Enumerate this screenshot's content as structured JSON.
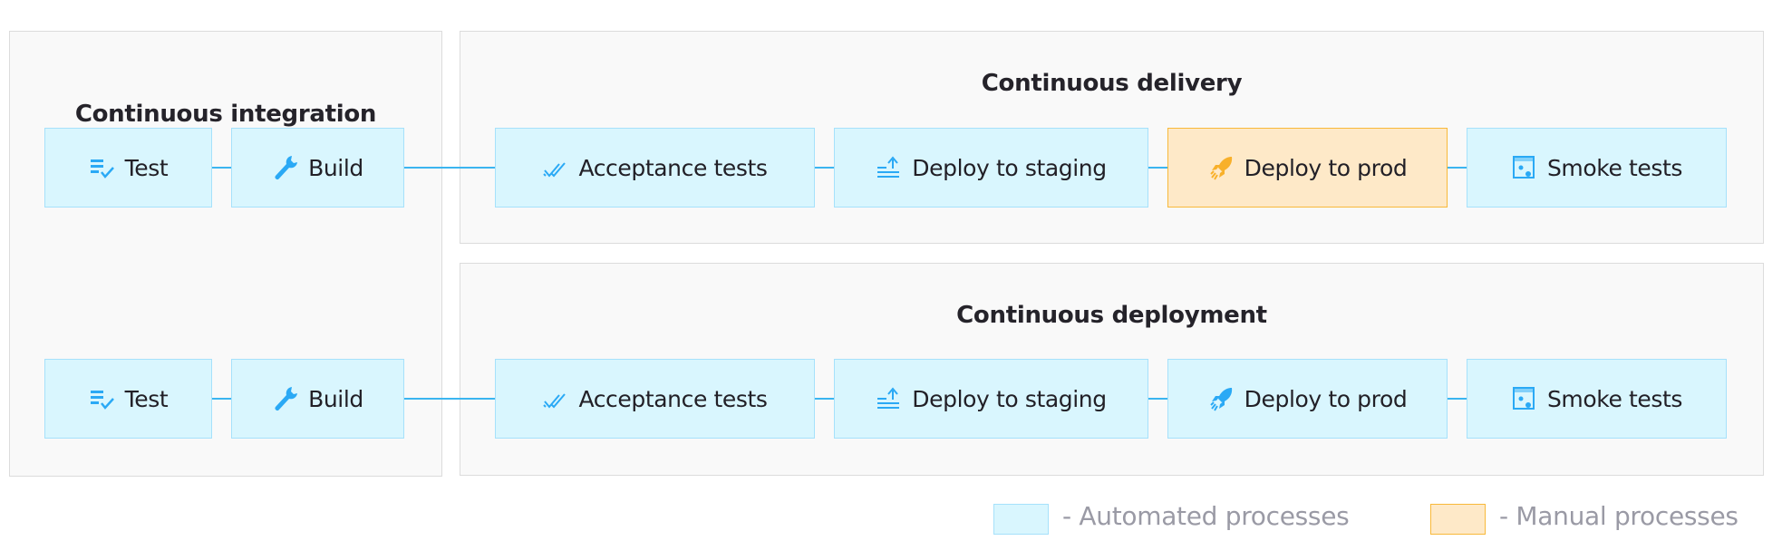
{
  "panels": {
    "integration": {
      "title": "Continuous integration"
    },
    "delivery": {
      "title": "Continuous delivery"
    },
    "deployment": {
      "title": "Continuous deployment"
    }
  },
  "rows": [
    {
      "steps": [
        {
          "label": "Test",
          "icon": "checklist-icon",
          "type": "automated"
        },
        {
          "label": "Build",
          "icon": "wrench-icon",
          "type": "automated"
        },
        {
          "label": "Acceptance tests",
          "icon": "double-check-icon",
          "type": "automated"
        },
        {
          "label": "Deploy to staging",
          "icon": "upload-lines-icon",
          "type": "automated"
        },
        {
          "label": "Deploy to prod",
          "icon": "rocket-icon",
          "type": "manual"
        },
        {
          "label": "Smoke tests",
          "icon": "browser-gear-icon",
          "type": "automated"
        }
      ]
    },
    {
      "steps": [
        {
          "label": "Test",
          "icon": "checklist-icon",
          "type": "automated"
        },
        {
          "label": "Build",
          "icon": "wrench-icon",
          "type": "automated"
        },
        {
          "label": "Acceptance tests",
          "icon": "double-check-icon",
          "type": "automated"
        },
        {
          "label": "Deploy to staging",
          "icon": "upload-lines-icon",
          "type": "automated"
        },
        {
          "label": "Deploy to prod",
          "icon": "rocket-icon",
          "type": "automated"
        },
        {
          "label": "Smoke tests",
          "icon": "browser-gear-icon",
          "type": "automated"
        }
      ]
    }
  ],
  "legend": {
    "automated": "- Automated processes",
    "manual": "- Manual processes"
  },
  "colors": {
    "automated_fill": "#d9f6fe",
    "automated_border": "#a6e1fb",
    "manual_fill": "#fee9c8",
    "manual_border": "#f8b93a",
    "connector": "#3bb5f0",
    "icon_blue": "#2aa9f5",
    "icon_orange": "#f8b02a"
  }
}
